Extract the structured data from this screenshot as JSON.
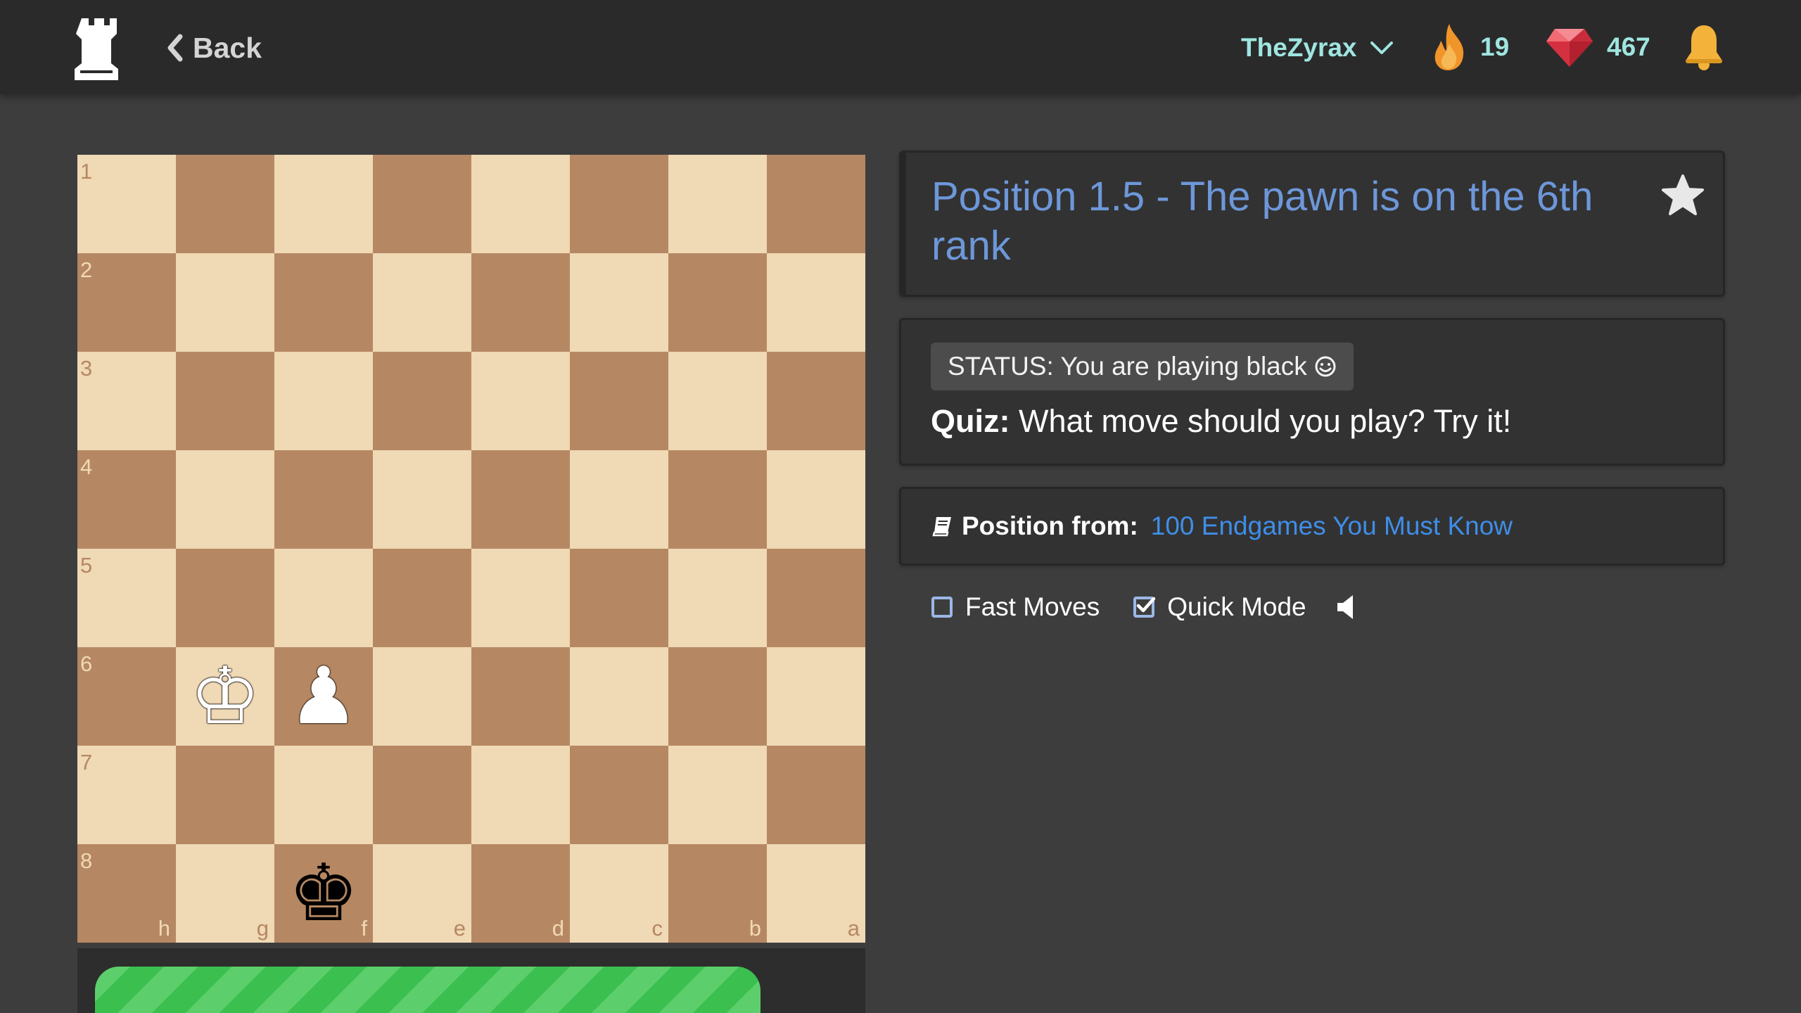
{
  "header": {
    "back_label": "Back",
    "username": "TheZyrax",
    "streak_count": "19",
    "gem_count": "467"
  },
  "board": {
    "ranks": [
      "1",
      "2",
      "3",
      "4",
      "5",
      "6",
      "7",
      "8"
    ],
    "files": [
      "h",
      "g",
      "f",
      "e",
      "d",
      "c",
      "b",
      "a"
    ],
    "pieces": [
      {
        "square": "g6",
        "glyph": "♔",
        "color": "white",
        "name": "white-king"
      },
      {
        "square": "f6",
        "glyph": "♟",
        "color": "white",
        "name": "white-pawn"
      },
      {
        "square": "f8",
        "glyph": "♚",
        "color": "black",
        "name": "black-king"
      }
    ]
  },
  "progress": {
    "fraction": 0.86
  },
  "position": {
    "title": "Position 1.5 - The pawn is on the 6th rank"
  },
  "status": {
    "text": "STATUS: You are playing black",
    "quiz_label": "Quiz:",
    "quiz_text": " What move should you play? Try it!"
  },
  "source": {
    "label": "Position from:",
    "link_text": "100 Endgames You Must Know"
  },
  "options": {
    "fast_moves_label": "Fast Moves",
    "fast_moves_checked": false,
    "quick_mode_label": "Quick Mode",
    "quick_mode_checked": true
  },
  "colors": {
    "light_square": "#f0d9b5",
    "dark_square": "#b58863",
    "title_blue": "#6d97d9",
    "link_blue": "#3f8ee8",
    "progress_green": "#3bbf4f",
    "username_teal": "#9fe5e0"
  }
}
